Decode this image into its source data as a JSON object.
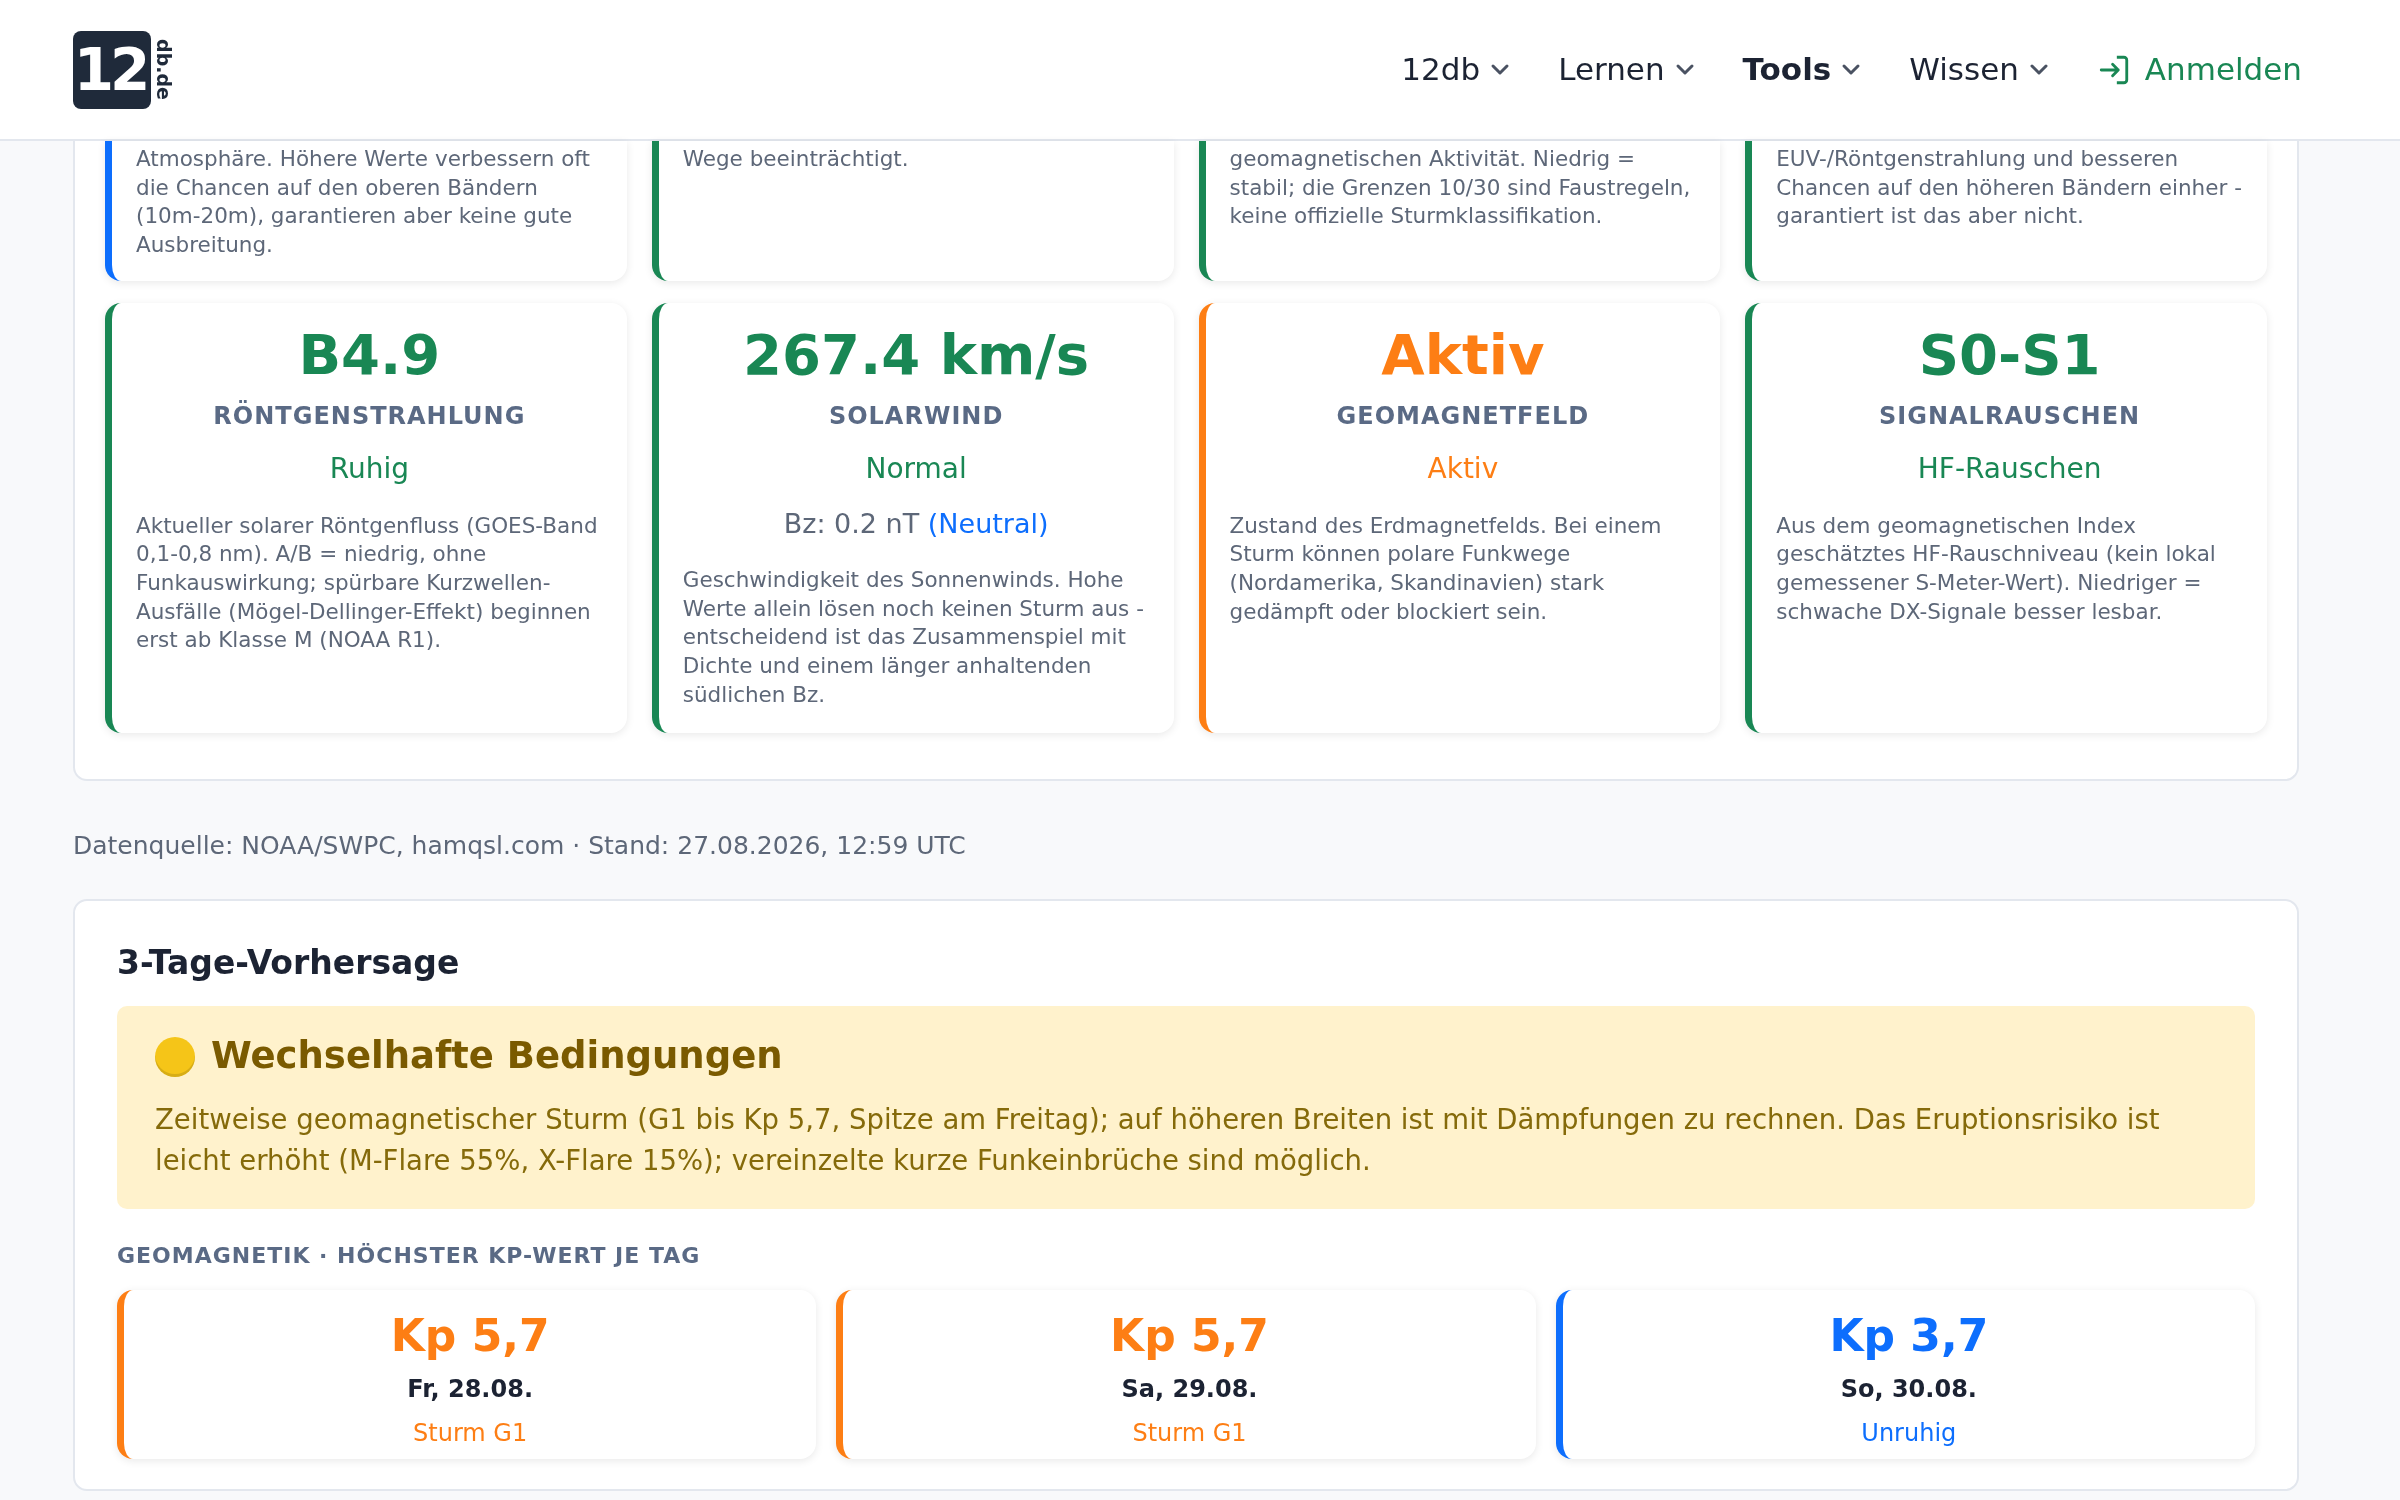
{
  "nav": {
    "logo": {
      "main": "12",
      "sub": "db.de"
    },
    "menu": [
      {
        "label": "12db",
        "selected": false
      },
      {
        "label": "Lernen",
        "selected": false
      },
      {
        "label": "Tools",
        "selected": true
      },
      {
        "label": "Wissen",
        "selected": false
      }
    ],
    "login": "Anmelden"
  },
  "top_cards": [
    {
      "color": "#0d6efd",
      "text": "Atmosphäre. Höhere Werte verbessern oft die Chancen auf den oberen Bändern (10m-20m), garantieren aber keine gute Ausbreitung."
    },
    {
      "color": "#198754",
      "text": "Wege beeinträchtigt."
    },
    {
      "color": "#198754",
      "text": "geomagnetischen Aktivität. Niedrig = stabil; die Grenzen 10/30 sind Faustregeln, keine offizielle Sturmklassifikation."
    },
    {
      "color": "#198754",
      "text": "EUV-/Röntgenstrahlung und besseren Chancen auf den höheren Bändern einher - garantiert ist das aber nicht."
    }
  ],
  "metric_cards": [
    {
      "color": "#198754",
      "value": "B4.9",
      "title": "RÖNTGENSTRAHLUNG",
      "status": "Ruhig",
      "description": "Aktueller solarer Röntgenfluss (GOES-Band 0,1-0,8 nm). A/B = niedrig, ohne Funkauswirkung; spürbare Kurzwellen-Ausfälle (Mögel-Dellinger-Effekt) beginnen erst ab Klasse M (NOAA R1)."
    },
    {
      "color": "#198754",
      "value": "267.4 km/s",
      "title": "SOLARWIND",
      "status": "Normal",
      "bz": {
        "reading": "Bz: 0.2 nT",
        "tag": "(Neutral)"
      },
      "description": "Geschwindigkeit des Sonnenwinds. Hohe Werte allein lösen noch keinen Sturm aus - entscheidend ist das Zusammenspiel mit Dichte und einem länger anhaltenden südlichen Bz."
    },
    {
      "color": "#fd7e14",
      "value": "Aktiv",
      "title": "GEOMAGNETFELD",
      "status": "Aktiv",
      "description": "Zustand des Erdmagnetfelds. Bei einem Sturm können polare Funkwege (Nordamerika, Skandinavien) stark gedämpft oder blockiert sein."
    },
    {
      "color": "#198754",
      "value": "S0-S1",
      "title": "SIGNALRAUSCHEN",
      "status": "HF-Rauschen",
      "description": "Aus dem geomagnetischen Index geschätztes HF-Rauschniveau (kein lokal gemessener S-Meter-Wert). Niedriger = schwache DX-Signale besser lesbar."
    }
  ],
  "source": "Datenquelle: NOAA/SWPC, hamqsl.com · Stand: 27.08.2026, 12:59 UTC",
  "forecast": {
    "title": "3-Tage-Vorhersage",
    "alert": {
      "title": "Wechselhafte Bedingungen",
      "text": "Zeitweise geomagnetischer Sturm (G1 bis Kp 5,7, Spitze am Freitag); auf höheren Breiten ist mit Dämpfungen zu rechnen. Das Eruptionsrisiko ist leicht erhöht (M-Flare 55%, X-Flare 15%); vereinzelte kurze Funkeinbrüche sind möglich."
    },
    "section_label": "GEOMAGNETIK · HÖCHSTER KP-WERT JE TAG",
    "days": [
      {
        "color": "#fd7e14",
        "kp": "Kp 5,7",
        "date": "Fr, 28.08.",
        "status": "Sturm G1"
      },
      {
        "color": "#fd7e14",
        "kp": "Kp 5,7",
        "date": "Sa, 29.08.",
        "status": "Sturm G1"
      },
      {
        "color": "#0d6efd",
        "kp": "Kp 3,7",
        "date": "So, 30.08.",
        "status": "Unruhig"
      }
    ]
  }
}
